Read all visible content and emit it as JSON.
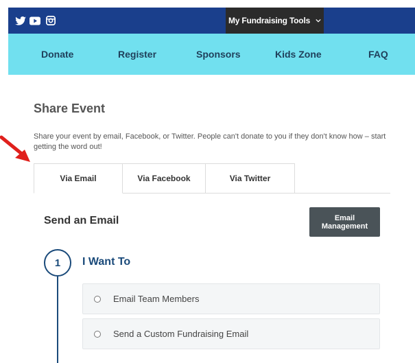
{
  "header": {
    "social": [
      "twitter-icon",
      "youtube-icon",
      "instagram-icon"
    ],
    "tools_label": "My Fundraising Tools",
    "tools_chevron": "⌄"
  },
  "nav": {
    "items": [
      "Donate",
      "Register",
      "Sponsors",
      "Kids Zone",
      "FAQ"
    ]
  },
  "share": {
    "title": "Share Event",
    "description": "Share your event by email, Facebook, or Twitter. People can't donate to you if they don't know how – start getting the word out!"
  },
  "tabs": [
    "Via Email",
    "Via Facebook",
    "Via Twitter"
  ],
  "email": {
    "title": "Send an Email",
    "management_label": "Email Management"
  },
  "step": {
    "number": "1",
    "title": "I Want To",
    "options": [
      "Email Team Members",
      "Send a Custom Fundraising Email"
    ]
  },
  "colors": {
    "topbar": "#1a3f8c",
    "navbar": "#71e0ef",
    "accent": "#1a4a7a",
    "arrow": "#e0201c"
  }
}
